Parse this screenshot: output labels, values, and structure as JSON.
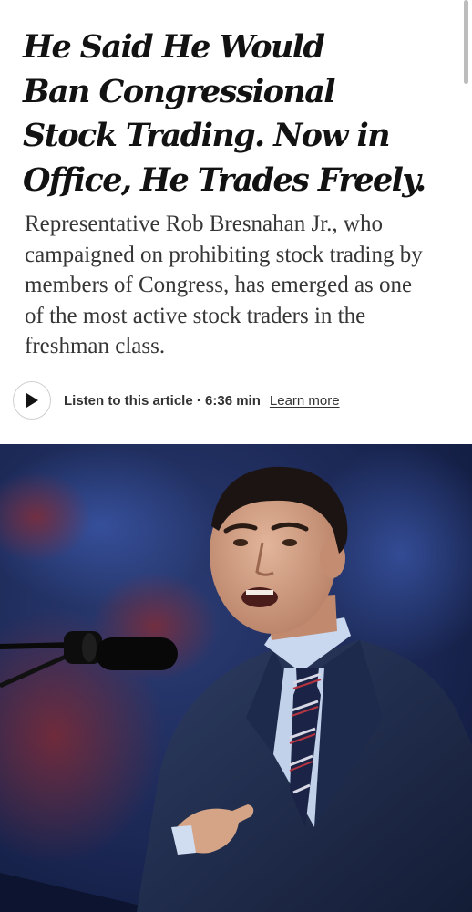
{
  "article": {
    "headline_lines": [
      "He Said He Would",
      "Ban Congressional",
      "Stock Trading. Now in",
      "Office, He Trades Freely."
    ],
    "summary_lines": [
      "Representative Rob Bresnahan Jr., who",
      "campaigned on prohibiting stock trading by",
      "members of Congress, has emerged as one",
      "of the most active stock traders in the",
      "freshman class."
    ]
  },
  "audio": {
    "play_icon": "play-icon",
    "listen_label": "Listen to this article · 6:36 min",
    "learn_more_label": "Learn more"
  },
  "photo": {
    "subject": "photo of a man in a navy suit and striped tie speaking at a microphone"
  },
  "colors": {
    "text": "#121212",
    "summary_text": "#363636",
    "background": "#ffffff"
  }
}
